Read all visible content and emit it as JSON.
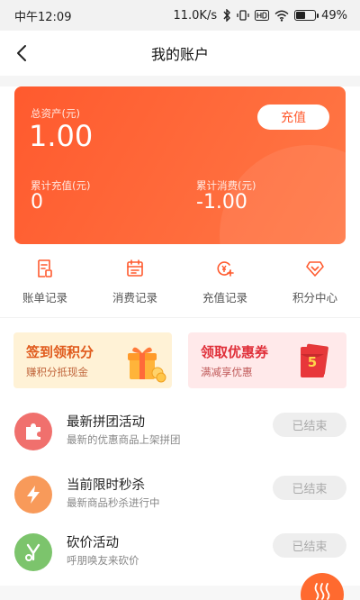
{
  "status_bar": {
    "time": "中午12:09",
    "network_speed": "11.0K/s",
    "battery": "49%",
    "battery_level": 0.49,
    "icons": [
      "bluetooth-icon",
      "vibrate-icon",
      "hd-icon",
      "wifi-icon",
      "battery-icon"
    ]
  },
  "nav": {
    "title": "我的账户",
    "back_icon": "chevron-left-icon"
  },
  "account_card": {
    "total_assets_label": "总资产(元)",
    "total_assets_value": "1.00",
    "recharge_button": "充值",
    "total_recharge_label": "累计充值(元)",
    "total_recharge_value": "0",
    "total_spend_label": "累计消费(元)",
    "total_spend_value": "-1.00",
    "gradient": [
      "#ff5a2e",
      "#ff7846"
    ]
  },
  "quick_links": [
    {
      "label": "账单记录",
      "icon": "bill-icon"
    },
    {
      "label": "消费记录",
      "icon": "calendar-icon"
    },
    {
      "label": "充值记录",
      "icon": "recharge-icon"
    },
    {
      "label": "积分中心",
      "icon": "diamond-icon"
    }
  ],
  "promos": [
    {
      "title": "签到领积分",
      "subtitle": "赚积分抵现金",
      "icon": "gift-box-icon",
      "bg": "#fff2d6"
    },
    {
      "title": "领取优惠券",
      "subtitle": "满减享优惠",
      "icon": "red-envelope-icon",
      "bg": "#ffe9ea",
      "envelope_number": "5"
    }
  ],
  "activities": [
    {
      "title": "最新拼团活动",
      "subtitle": "最新的优惠商品上架拼团",
      "button": "已结束",
      "icon": "puzzle-icon",
      "color": "#f0706d"
    },
    {
      "title": "当前限时秒杀",
      "subtitle": "最新商品秒杀进行中",
      "button": "已结束",
      "icon": "lightning-icon",
      "color": "#f89a5a"
    },
    {
      "title": "砍价活动",
      "subtitle": "呼朋唤友来砍价",
      "button": "已结束",
      "icon": "cut-icon",
      "color": "#7cc46c"
    }
  ],
  "accent": "#ff5a2e",
  "float_button_icon": "waves-icon"
}
